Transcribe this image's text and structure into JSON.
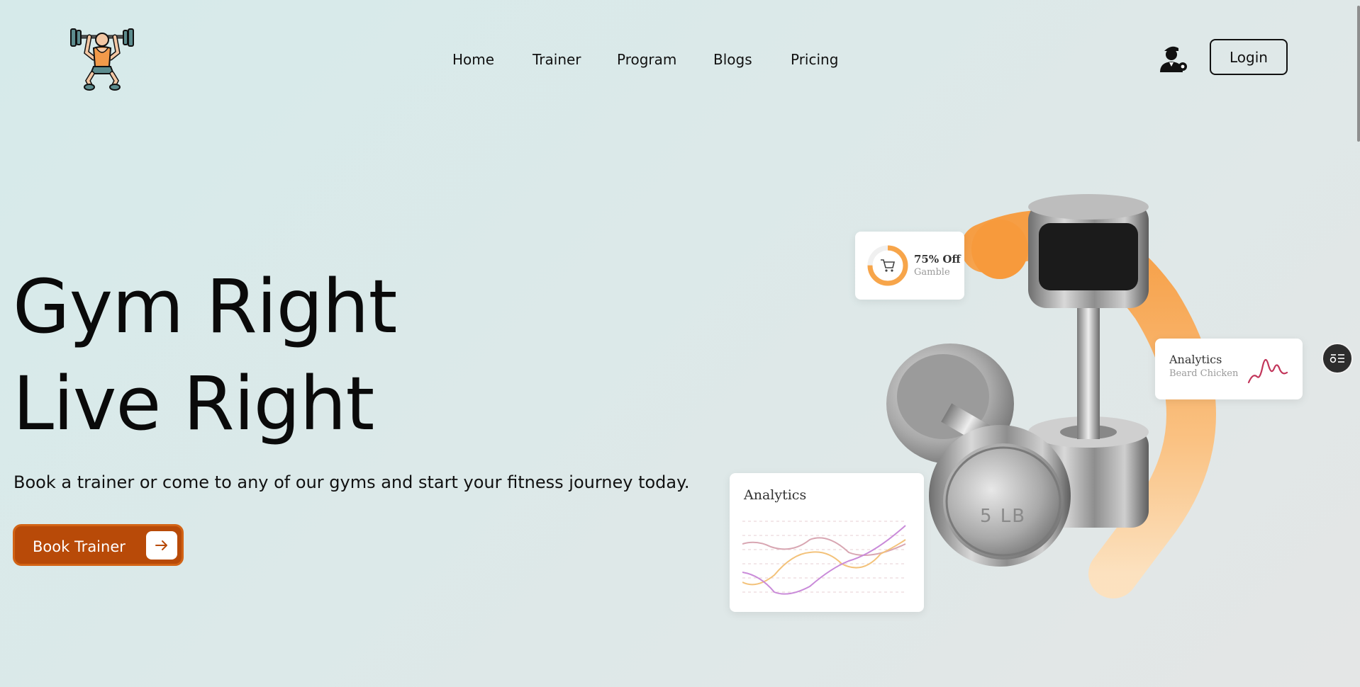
{
  "brand": {
    "logo_icon": "weightlifter-icon"
  },
  "nav": {
    "items": [
      {
        "label": "Home"
      },
      {
        "label": "Trainer"
      },
      {
        "label": "Program"
      },
      {
        "label": "Blogs"
      },
      {
        "label": "Pricing"
      }
    ]
  },
  "header": {
    "user_icon": "trainer-profile-icon",
    "login_label": "Login"
  },
  "hero": {
    "title_line1": "Gym Right",
    "title_line2": "Live Right",
    "subtitle": "Book a trainer or come to any of our gyms and start your fitness journey today.",
    "cta_label": "Book Trainer",
    "cta_icon": "arrow-right-icon"
  },
  "illustration": {
    "discount_card": {
      "title": "75% Off",
      "subtitle": "Gamble",
      "icon": "cart-icon"
    },
    "analytics_small": {
      "title": "Analytics",
      "subtitle": "Beard Chicken"
    },
    "analytics_big": {
      "title": "Analytics"
    },
    "dumbbell_label": "5 LB"
  },
  "colors": {
    "accent": "#b84a08",
    "accent_border": "#d26315",
    "orange_ring": "#f7a54a",
    "background": "#d6eaea"
  },
  "side_widget_icon": "list-settings-icon"
}
